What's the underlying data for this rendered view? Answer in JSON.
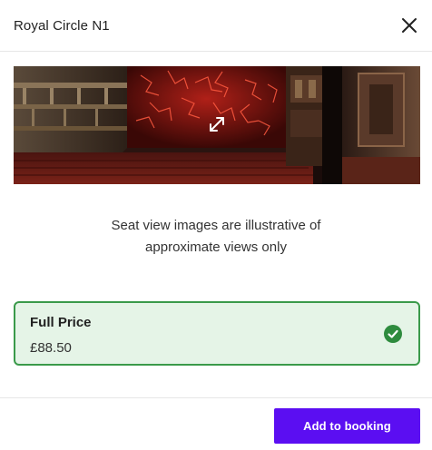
{
  "header": {
    "title": "Royal Circle N1",
    "close_icon": "close-icon"
  },
  "seat_view": {
    "image_description_icon": "expand-icon",
    "disclaimer_line1": "Seat view images are illustrative of",
    "disclaimer_line2": "approximate views only"
  },
  "price_option": {
    "name": "Full Price",
    "amount": "£88.50",
    "selected": true,
    "status_icon": "check-circle-icon"
  },
  "footer": {
    "add_button_label": "Add to booking"
  },
  "colors": {
    "accent": "#5b0ef2",
    "selected_border": "#3a9a4a",
    "selected_background": "#e5f4e7",
    "check": "#2e8b3e"
  }
}
